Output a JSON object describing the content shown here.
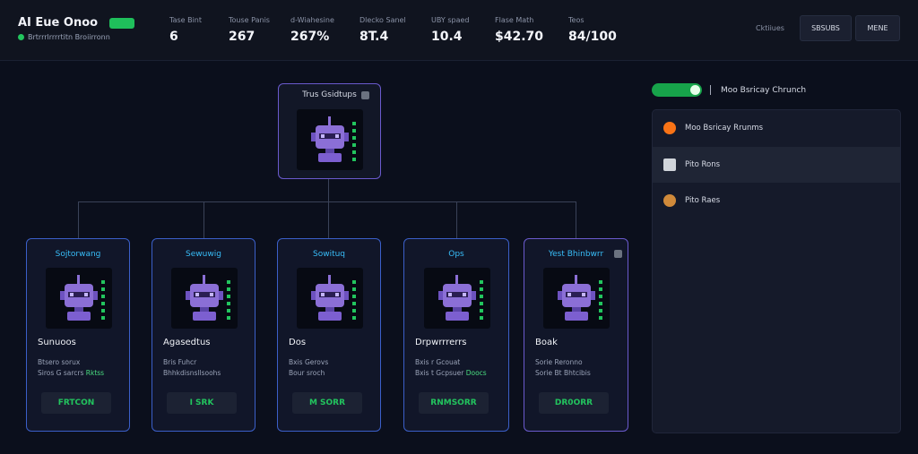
{
  "header": {
    "title": "AI Eue Onoo",
    "badge": "",
    "subtitle": "Brtrrrlrrrrtitn Broiirronn",
    "stats": [
      {
        "label": "Tase Bint",
        "value": "6"
      },
      {
        "label": "Touse Panis",
        "value": "267"
      },
      {
        "label": "d-Wiahesine",
        "value": "267%"
      },
      {
        "label": "Dlecko Sanel",
        "value": "8T.4"
      },
      {
        "label": "UBY spaed",
        "value": "10.4"
      },
      {
        "label": "Flase Math",
        "value": "$42.70"
      },
      {
        "label": "Teos",
        "value": "84/100"
      }
    ],
    "link": "Cktiiues",
    "buttons": [
      "SBSUBS",
      "MENE"
    ]
  },
  "root": {
    "title": "Trus Gsidtups"
  },
  "children": [
    {
      "title": "Sojtorwang",
      "name": "Sunuoos",
      "desc1": "Btsero sorux",
      "desc2": "Siros G sarcrs",
      "desc2_hl": "Rktss",
      "button": "FRTCON"
    },
    {
      "title": "Sewuwig",
      "name": "Agasedtus",
      "desc1": "Bris Fuhcr",
      "desc2": "Bhhkdisnsllsoohs",
      "desc2_hl": "",
      "button": "I SRK"
    },
    {
      "title": "Sowituq",
      "name": "Dos",
      "desc1": "Bxis Gerovs",
      "desc2": "Bour sroch",
      "desc2_hl": "",
      "button": "M SORR"
    },
    {
      "title": "Ops",
      "name": "Drpwrrrerrs",
      "desc1": "Bxis r Gcouat",
      "desc2": "Bxis t Gcpsuer",
      "desc2_hl": "Doocs",
      "button": "RNMSORR"
    },
    {
      "title": "Yest Bhinbwrr",
      "name": "Boak",
      "desc1": "Sorie Reronno",
      "desc2": "Sorie Bt Bhtcibis",
      "desc2_hl": "",
      "button": "DR0ORR"
    }
  ],
  "panel": {
    "toggle_label": "",
    "title": "Moo Bsricay Chrunch",
    "items": [
      {
        "label": "Moo Bsricay Rrunms",
        "icon": "shield-icon"
      },
      {
        "label": "Pito Rons",
        "icon": "link-icon"
      },
      {
        "label": "Pito Raes",
        "icon": "lion-icon"
      }
    ]
  },
  "colors": {
    "accent_green": "#22c55e",
    "accent_blue": "#38bdf8",
    "border_blue": "#3b5fc8",
    "border_purple": "#6a5acd"
  }
}
